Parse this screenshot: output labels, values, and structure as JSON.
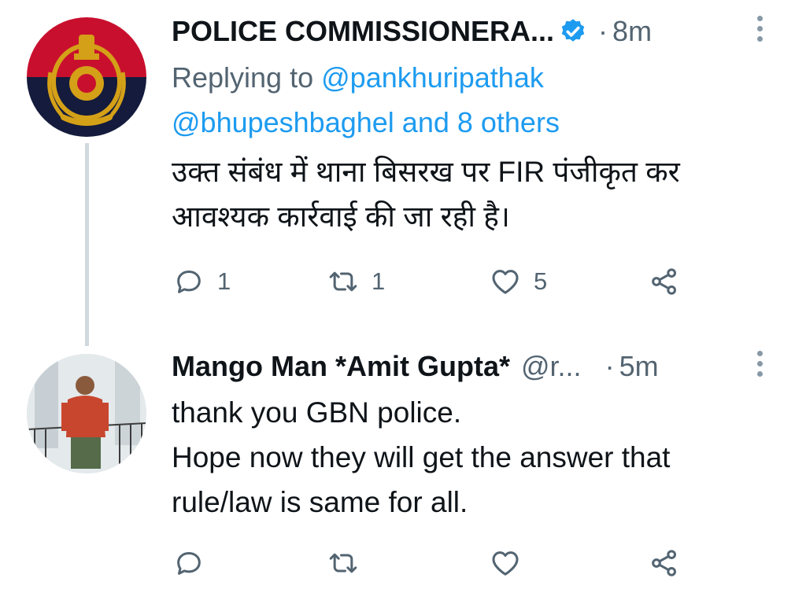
{
  "tweets": [
    {
      "author_name": "POLICE COMMISSIONERA...",
      "verified": true,
      "time": "8m",
      "replying_prefix": "Replying to",
      "replying_user1": "@pankhuripathak",
      "replying_user2": "@bhupeshbaghel",
      "replying_and": "and 8 others",
      "text_lines": [
        "उक्त संबंध में थाना बिसरख पर FIR पंजीकृत कर",
        "आवश्यक कार्रवाई की जा रही है।"
      ],
      "reply_count": "1",
      "retweet_count": "1",
      "like_count": "5"
    },
    {
      "author_name": "Mango Man *Amit Gupta*",
      "handle": "@r...",
      "time": "5m",
      "text_lines": [
        "thank you GBN police.",
        "Hope now they will get the answer that",
        "rule/law is same for all."
      ]
    }
  ],
  "icons": [
    "verified-badge-icon",
    "more-options-icon",
    "reply-icon",
    "retweet-icon",
    "like-icon",
    "share-icon"
  ],
  "colors": {
    "link": "#1d9bf0",
    "muted": "#536471",
    "thread_line": "#cfd9de",
    "avatar_red": "#c8102e",
    "avatar_navy": "#141b3c"
  }
}
